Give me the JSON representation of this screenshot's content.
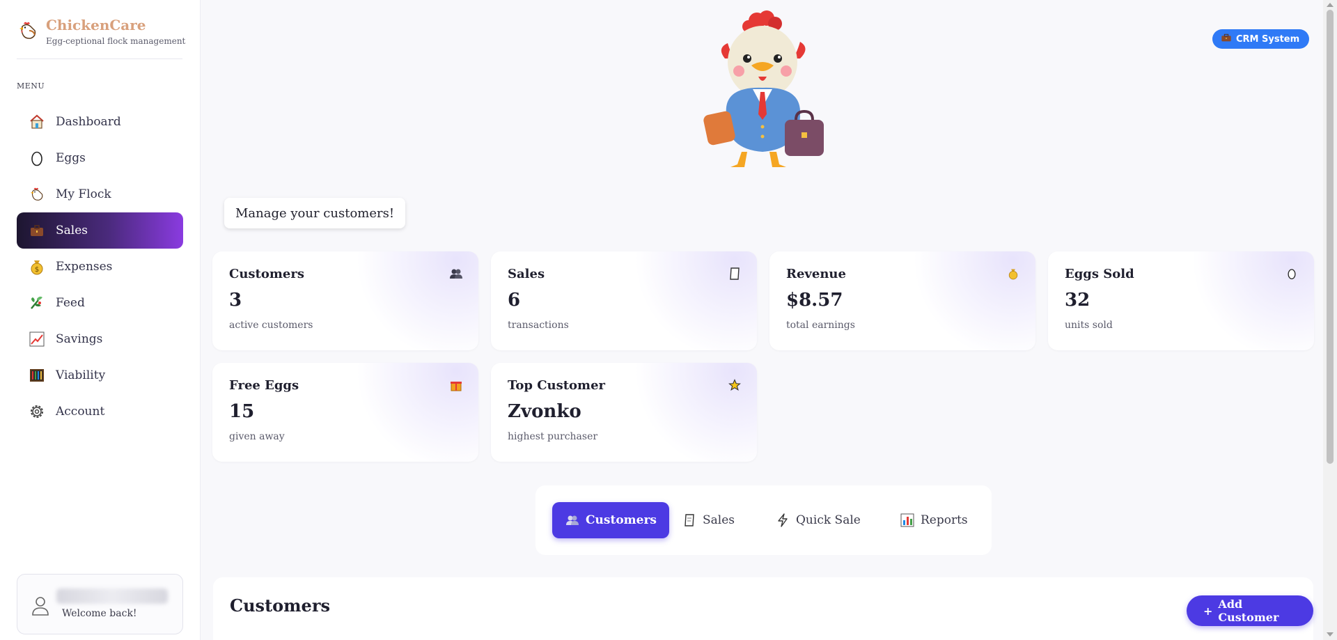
{
  "brand": {
    "title": "ChickenCare",
    "subtitle": "Egg-ceptional flock management"
  },
  "menu": {
    "label": "MENU",
    "items": [
      {
        "label": "Dashboard",
        "icon": "house-icon"
      },
      {
        "label": "Eggs",
        "icon": "egg-icon"
      },
      {
        "label": "My Flock",
        "icon": "chicken-icon"
      },
      {
        "label": "Sales",
        "icon": "briefcase-icon",
        "active": true
      },
      {
        "label": "Expenses",
        "icon": "money-bag-icon"
      },
      {
        "label": "Feed",
        "icon": "plant-icon"
      },
      {
        "label": "Savings",
        "icon": "chart-up-icon"
      },
      {
        "label": "Viability",
        "icon": "abacus-icon"
      },
      {
        "label": "Account",
        "icon": "gear-icon"
      }
    ]
  },
  "user": {
    "welcome": "Welcome back!"
  },
  "header": {
    "badge": "CRM System"
  },
  "speech": "Manage your customers!",
  "stats": [
    {
      "title": "Customers",
      "value": "3",
      "sub": "active customers",
      "icon": "people-icon"
    },
    {
      "title": "Sales",
      "value": "6",
      "sub": "transactions",
      "icon": "receipt-icon"
    },
    {
      "title": "Revenue",
      "value": "$8.57",
      "sub": "total earnings",
      "icon": "money-bag-icon"
    },
    {
      "title": "Eggs Sold",
      "value": "32",
      "sub": "units sold",
      "icon": "egg-icon"
    },
    {
      "title": "Free Eggs",
      "value": "15",
      "sub": "given away",
      "icon": "gift-icon"
    },
    {
      "title": "Top Customer",
      "value": "Zvonko",
      "sub": "highest purchaser",
      "icon": "star-icon"
    }
  ],
  "tabs": [
    {
      "label": "Customers",
      "icon": "people-icon",
      "active": true
    },
    {
      "label": "Sales",
      "icon": "receipt-icon"
    },
    {
      "label": "Quick Sale",
      "icon": "lightning-icon"
    },
    {
      "label": "Reports",
      "icon": "bar-chart-icon"
    }
  ],
  "panel": {
    "title": "Customers",
    "add_label": "Add Customer",
    "add_prefix": "+"
  },
  "colors": {
    "accent": "#4c3ae3",
    "badge": "#2f7af6",
    "brand": "#d8a07c"
  }
}
